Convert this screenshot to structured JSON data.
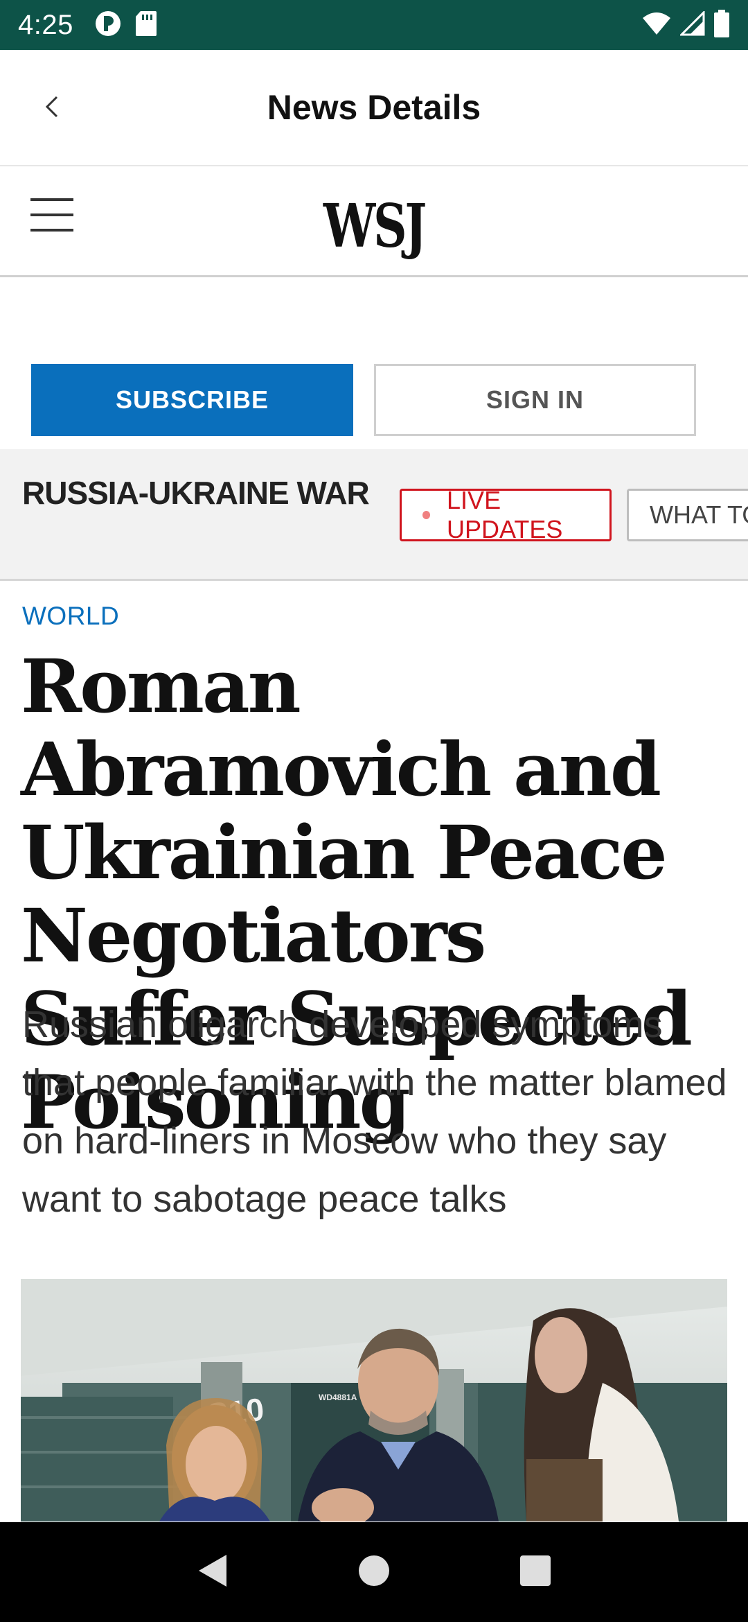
{
  "status_bar": {
    "time": "4:25"
  },
  "app_bar": {
    "title": "News Details"
  },
  "site": {
    "logo_text": "WSJ"
  },
  "account": {
    "subscribe_label": "SUBSCRIBE",
    "signin_label": "SIGN IN"
  },
  "topic_band": {
    "topic": "RUSSIA-UKRAINE WAR",
    "live_label": "LIVE UPDATES",
    "second_label": "WHAT TO"
  },
  "article": {
    "section": "WORLD",
    "headline": "Roman Abramovich and Ukrainian Peace Negotiators Suffer Suspected Poisoning",
    "dek": "Russian oligarch developed symptoms that people familiar with the matter blamed on hard-liners in Moscow who they say want to sabotage peace talks"
  },
  "photo_sign": {
    "number": "S10",
    "label": "WD4881A"
  },
  "colors": {
    "status_bar": "#0d5348",
    "subscribe": "#0a6fbc",
    "live": "#d0141d",
    "section": "#0a6fbc"
  },
  "icons": {
    "back": "chevron-left-icon",
    "menu": "hamburger-menu-icon",
    "nav_back": "triangle-back-icon",
    "nav_home": "circle-home-icon",
    "nav_recents": "square-recents-icon"
  }
}
